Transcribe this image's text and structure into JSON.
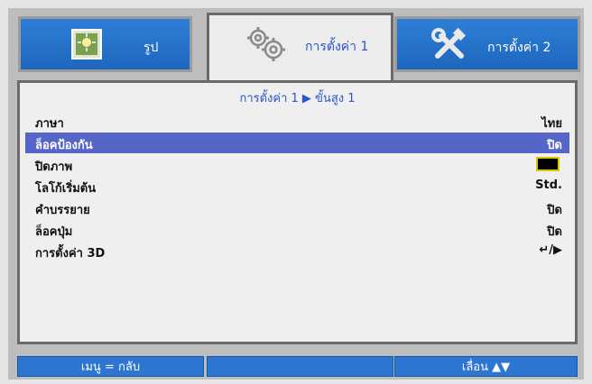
{
  "tabs": [
    {
      "label": "รูป",
      "icon": "picture-icon",
      "state": "inactive"
    },
    {
      "label": "การตั้งค่า 1",
      "icon": "gears-icon",
      "state": "active"
    },
    {
      "label": "การตั้งค่า 2",
      "icon": "tools-icon",
      "state": "inactive"
    }
  ],
  "panel": {
    "breadcrumb": "การตั้งค่า 1 ▶ ขั้นสูง 1",
    "items": [
      {
        "label": "ภาษา",
        "value": "ไทย"
      },
      {
        "label": "ล็อคป้องกัน",
        "value": "ปิด",
        "selected": true
      },
      {
        "label": "ปิดภาพ",
        "value": "",
        "swatch_color": "#000000"
      },
      {
        "label": "โลโก้เริ่มต้น",
        "value": "Std."
      },
      {
        "label": "คำบรรยาย",
        "value": "ปิด"
      },
      {
        "label": "ล็อคปุ่ม",
        "value": "ปิด"
      },
      {
        "label": "การตั้งค่า 3D",
        "value": "↵/▶"
      }
    ]
  },
  "footer": {
    "back": "เมนู = กลับ",
    "scroll": "เลื่อน ▲▼"
  },
  "colors": {
    "accent": "#2a55c8",
    "tab_blue": "#2c75d0",
    "selected_row": "#5566c8",
    "swatch_border": "#d9c800"
  }
}
